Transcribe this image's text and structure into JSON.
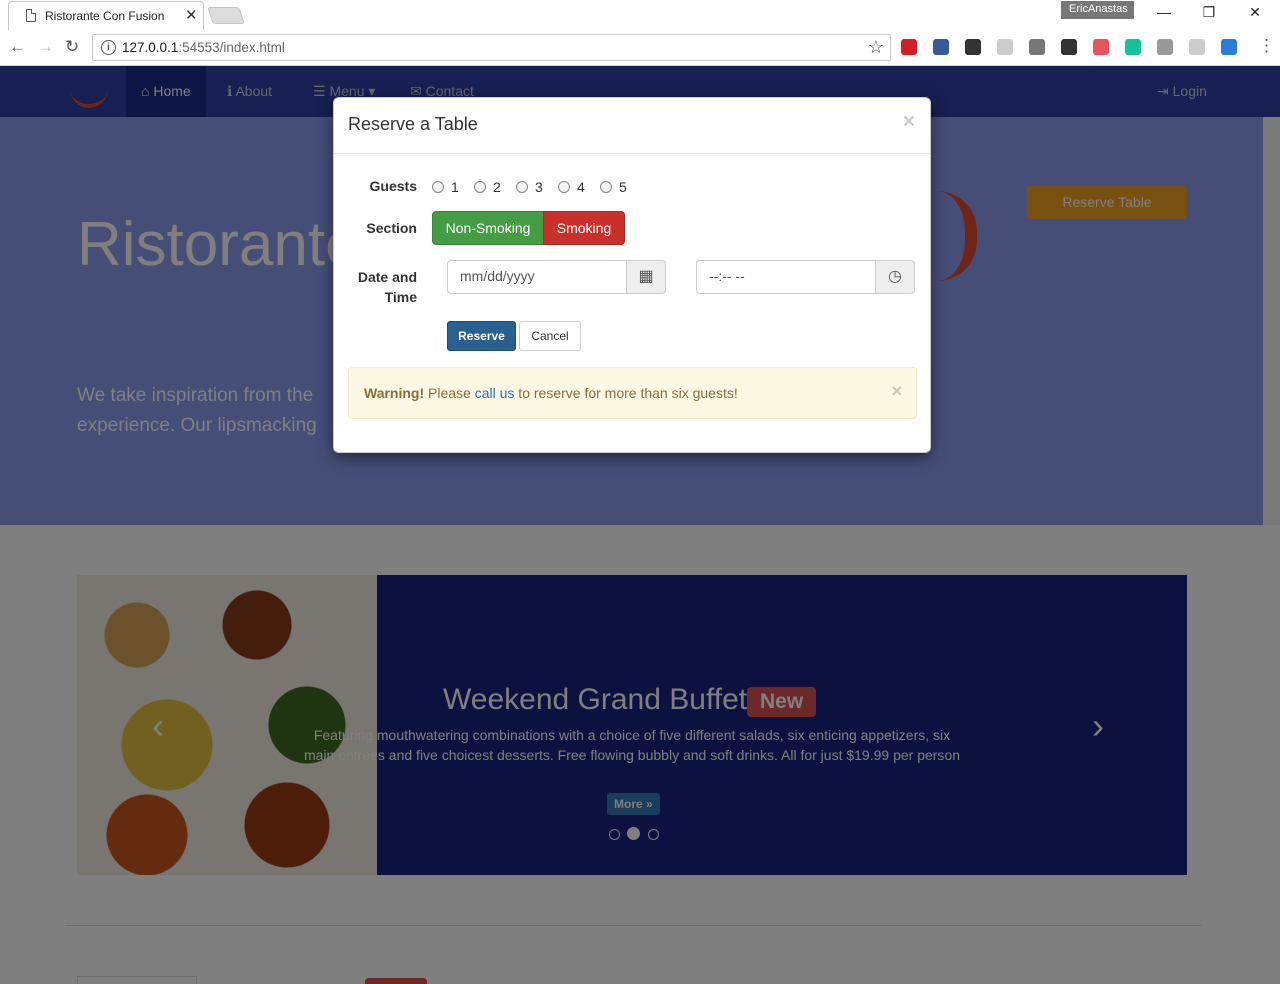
{
  "browser": {
    "tab_title": "Ristorante Con Fusion",
    "tab_close": "✕",
    "profile_name": "EricAnastas",
    "url_host": "127.0.0.1",
    "url_rest": ":54553/index.html",
    "win_minimize": "—",
    "win_restore": "❐",
    "win_close": "✕",
    "back": "←",
    "forward": "→",
    "reload": "↻",
    "bookmark_star": "☆",
    "menu_dots": "⋮",
    "extension_colors": [
      "#d11d23",
      "#3b5998",
      "#333333",
      "#cccccc",
      "#777777",
      "#333333",
      "#e8535c",
      "#15c39a",
      "#999999",
      "#cccccc",
      "#2d7bd6"
    ]
  },
  "navbar": {
    "items": [
      {
        "label": "Home",
        "icon": "home-icon",
        "glyph": "⌂"
      },
      {
        "label": "About",
        "icon": "info-icon",
        "glyph": "ℹ"
      },
      {
        "label": "Menu",
        "icon": "list-icon",
        "glyph": "☰"
      },
      {
        "label": "Contact",
        "icon": "envelope-icon",
        "glyph": "✉"
      }
    ],
    "menu_caret": "▾",
    "login": "Login",
    "login_glyph": "⇥"
  },
  "jumbotron": {
    "title": "Ristorante",
    "text_line1": "We take inspiration from the",
    "text_line2": "experience. Our lipsmacking",
    "reserve_button": "Reserve Table"
  },
  "carousel": {
    "title": "Weekend Grand Buffet",
    "badge": "New",
    "text": "Featuring mouthwatering combinations with a choice of five different salads, six enticing appetizers, six main entrees and five choicest desserts. Free flowing bubbly and soft drinks. All for just $19.99 per person",
    "more_button": "More »",
    "prev": "‹",
    "next": "›",
    "active_slide": 2,
    "slide_count": 3
  },
  "modal": {
    "title": "Reserve a Table",
    "close": "×",
    "guests_label": "Guests",
    "guest_options": [
      "1",
      "2",
      "3",
      "4",
      "5"
    ],
    "section_label": "Section",
    "section_options": [
      "Non-Smoking",
      "Smoking"
    ],
    "datetime_label_1": "Date and",
    "datetime_label_2": "Time",
    "date_placeholder": "mm/dd/yyyy",
    "time_placeholder": "--:-- --",
    "calendar_glyph": "▦",
    "clock_glyph": "◷",
    "reserve_button": "Reserve",
    "cancel_button": "Cancel",
    "alert": {
      "strong": "Warning!",
      "before_link": " Please ",
      "link": "call us",
      "after_link": " to reserve for more than six guests!",
      "close": "×"
    }
  }
}
